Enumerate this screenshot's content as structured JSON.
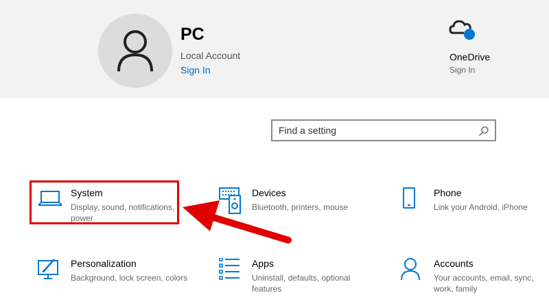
{
  "account": {
    "name": "PC",
    "type": "Local Account",
    "signin": "Sign In"
  },
  "onedrive": {
    "title": "OneDrive",
    "signin": "Sign In"
  },
  "search": {
    "placeholder": "Find a setting"
  },
  "tiles": [
    {
      "title": "System",
      "desc": "Display, sound, notifications, power",
      "icon": "laptop-icon"
    },
    {
      "title": "Devices",
      "desc": "Bluetooth, printers, mouse",
      "icon": "devices-icon"
    },
    {
      "title": "Phone",
      "desc": "Link your Android, iPhone",
      "icon": "phone-icon"
    },
    {
      "title": "Personalization",
      "desc": "Background, lock screen, colors",
      "icon": "personalization-icon"
    },
    {
      "title": "Apps",
      "desc": "Uninstall, defaults, optional features",
      "icon": "apps-icon"
    },
    {
      "title": "Accounts",
      "desc": "Your accounts, email, sync, work, family",
      "icon": "person-icon"
    }
  ],
  "colors": {
    "accent": "#0067c0",
    "icon_blue": "#0078d4",
    "highlight_red": "#e10000",
    "header_bg": "#f2f2f2"
  }
}
